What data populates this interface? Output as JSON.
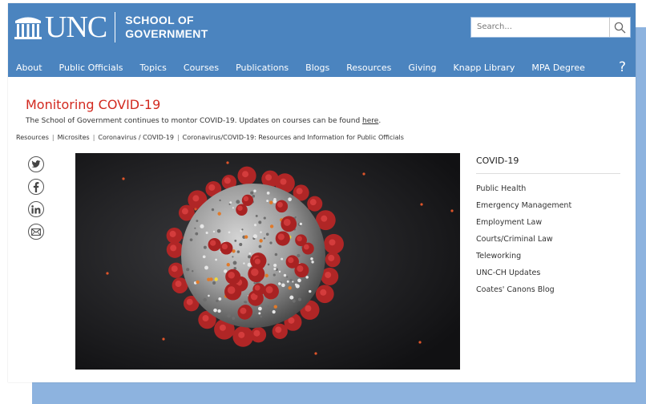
{
  "brand": {
    "logo_text": "UNC",
    "school_line1": "SCHOOL OF",
    "school_line2": "GOVERNMENT"
  },
  "search": {
    "placeholder": "Search..."
  },
  "nav": {
    "items": [
      {
        "label": "About"
      },
      {
        "label": "Public Officials"
      },
      {
        "label": "Topics"
      },
      {
        "label": "Courses"
      },
      {
        "label": "Publications"
      },
      {
        "label": "Blogs"
      },
      {
        "label": "Resources"
      },
      {
        "label": "Giving"
      },
      {
        "label": "Knapp Library"
      },
      {
        "label": "MPA Degree"
      }
    ],
    "help_label": "?"
  },
  "main": {
    "title": "Monitoring COVID-19",
    "notice_text": "The School of Government continues to montor COVID-19. Updates on courses can be found ",
    "notice_link": "here",
    "notice_end": "."
  },
  "breadcrumb": {
    "items": [
      "Resources",
      "Microsites",
      "Coronavirus / COVID-19",
      "Coronavirus/COVID-19: Resources and Information for Public Officials"
    ],
    "separator": "|"
  },
  "share": {
    "icons": [
      "twitter-icon",
      "facebook-icon",
      "linkedin-icon",
      "email-icon"
    ]
  },
  "sidebar": {
    "title": "COVID-19",
    "items": [
      {
        "label": "Public Health"
      },
      {
        "label": "Emergency Management"
      },
      {
        "label": "Employment Law"
      },
      {
        "label": "Courts/Criminal Law"
      },
      {
        "label": "Teleworking"
      },
      {
        "label": "UNC-CH Updates"
      },
      {
        "label": "Coates' Canons Blog"
      }
    ]
  },
  "colors": {
    "header_blue": "#4b84bf",
    "title_red": "#d2291f",
    "backdrop_blue": "#8db3df"
  }
}
